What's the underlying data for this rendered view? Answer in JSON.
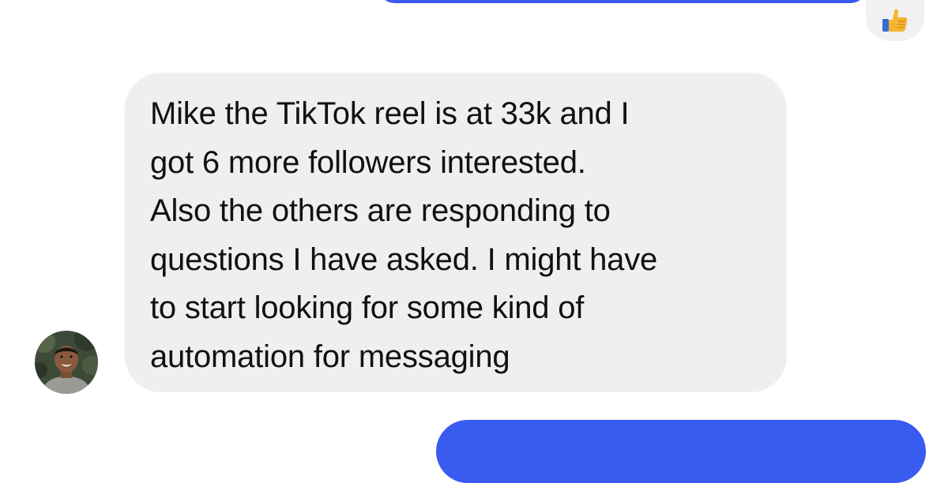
{
  "conversation": {
    "received_message": {
      "text": "Mike the TikTok reel is at 33k and I\ngot 6 more followers interested.\nAlso the others are responding to\nquestions I have asked. I might have\nto start looking for some kind of\nautomation for messaging"
    },
    "reaction": {
      "icon": "thumbs-up-icon"
    },
    "sender_avatar": {
      "icon": "person-avatar"
    }
  },
  "colors": {
    "sent_bubble": "#3a5bf0",
    "received_bubble": "#efeff1",
    "reaction_background": "#f1f1f3",
    "message_text": "#111111"
  }
}
